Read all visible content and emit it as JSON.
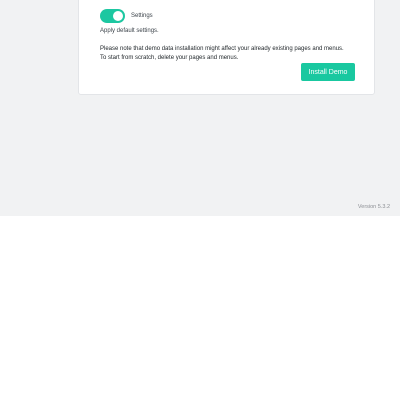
{
  "settings_toggle": {
    "label": "Settings",
    "state": "on"
  },
  "apply_hint": "Apply default settings.",
  "notice": {
    "line1": "Please note that demo data installation might affect your already existing pages and menus.",
    "line2": "To start from scratch, delete your pages and menus."
  },
  "install_button": {
    "label": "Install Demo"
  },
  "footer": {
    "version": "Version 5.3.2"
  },
  "colors": {
    "accent": "#19c8a0",
    "background": "#f1f2f3",
    "card": "#ffffff"
  }
}
